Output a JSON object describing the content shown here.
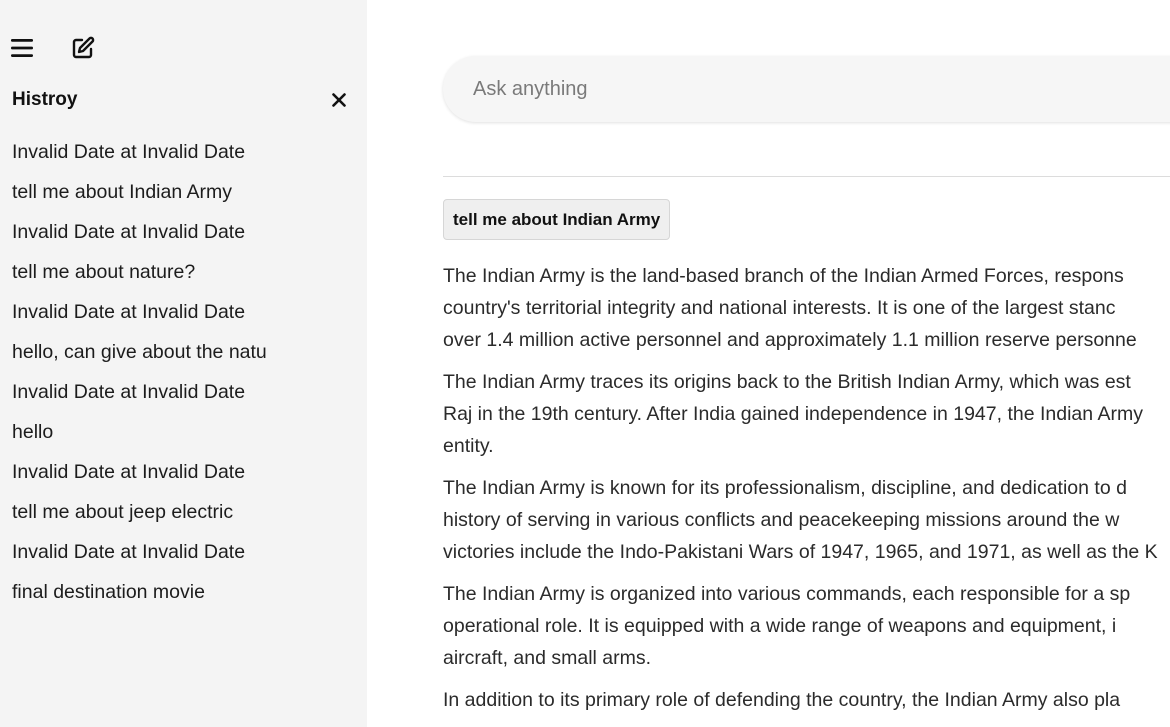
{
  "sidebar": {
    "history_title": "Histroy",
    "items": [
      "Invalid Date at Invalid Date",
      "tell me about Indian Army",
      "Invalid Date at Invalid Date",
      "tell me about nature?",
      "Invalid Date at Invalid Date",
      "hello, can give about the natu",
      "Invalid Date at Invalid Date",
      "hello",
      "Invalid Date at Invalid Date",
      "tell me about jeep electric",
      "Invalid Date at Invalid Date",
      "final destination movie"
    ]
  },
  "main": {
    "search_placeholder": "Ask anything",
    "query": "tell me about Indian Army",
    "answer_lines": [
      [
        "The Indian Army is the land-based branch of the Indian Armed Forces, respons",
        "country's territorial integrity and national interests. It is one of the largest stanc",
        "over 1.4 million active personnel and approximately 1.1 million reserve personne"
      ],
      [
        "The Indian Army traces its origins back to the British Indian Army, which was est",
        "Raj in the 19th century. After India gained independence in 1947, the Indian Army",
        "entity."
      ],
      [
        "The Indian Army is known for its professionalism, discipline, and dedication to d",
        "history of serving in various conflicts and peacekeeping missions around the w",
        "victories include the Indo-Pakistani Wars of 1947, 1965, and 1971, as well as the K"
      ],
      [
        "The Indian Army is organized into various commands, each responsible for a sp",
        "operational role. It is equipped with a wide range of weapons and equipment, i",
        "aircraft, and small arms."
      ],
      [
        "In addition to its primary role of defending the country, the Indian Army also pla"
      ]
    ]
  }
}
